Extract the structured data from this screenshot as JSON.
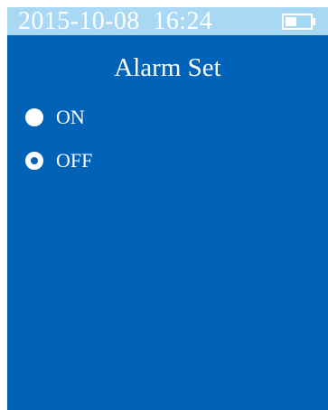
{
  "status_bar": {
    "datetime": "2015-10-08  16:24",
    "battery_icon": "battery-low-icon"
  },
  "screen": {
    "title": "Alarm Set",
    "background_color": "#0063b7",
    "status_bar_color": "#a8d8f4"
  },
  "options": [
    {
      "label": "ON",
      "selected": false
    },
    {
      "label": "OFF",
      "selected": true
    }
  ]
}
